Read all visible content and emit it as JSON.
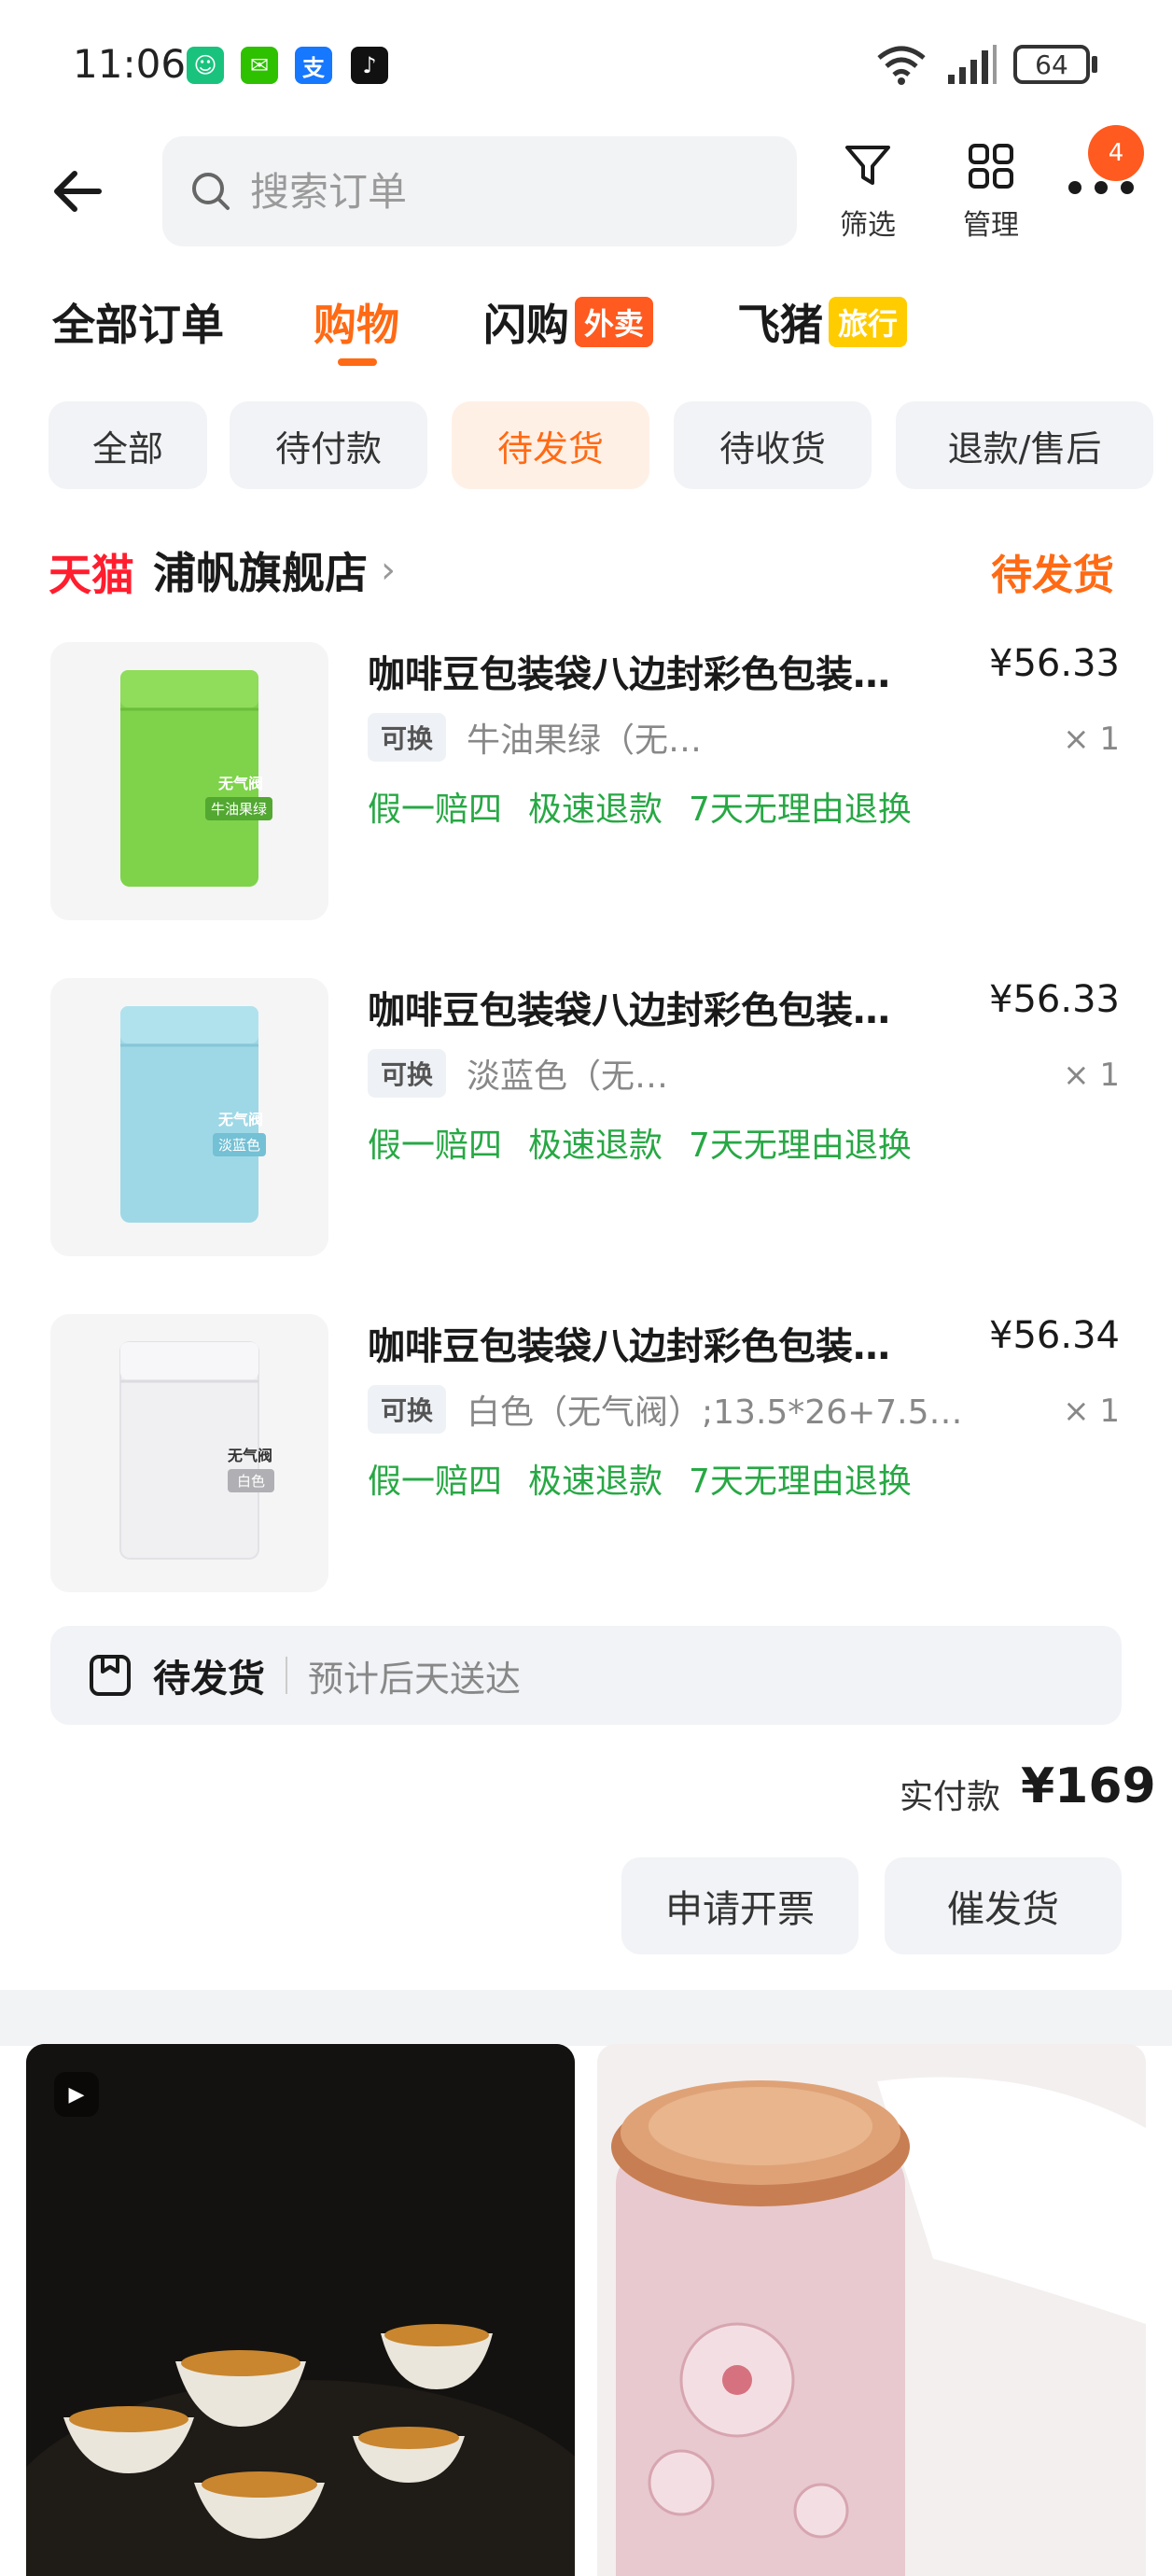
{
  "status_bar": {
    "time": "11:06",
    "battery": "64"
  },
  "search": {
    "placeholder": "搜索订单"
  },
  "header_tools": {
    "filter_label": "筛选",
    "manage_label": "管理",
    "more_badge": "4"
  },
  "main_tabs": [
    {
      "label": "全部订单"
    },
    {
      "label": "购物"
    },
    {
      "label": "闪购",
      "tag": "外卖"
    },
    {
      "label": "飞猪",
      "tag": "旅行"
    }
  ],
  "filters": [
    "全部",
    "待付款",
    "待发货",
    "待收货",
    "退款/售后"
  ],
  "store": {
    "brand": "天猫",
    "name": "浦帆旗舰店",
    "status": "待发货"
  },
  "items": [
    {
      "title": "咖啡豆包装袋八边封彩色包装…",
      "price": "¥56.33",
      "tag": "可换",
      "sku": "牛油果绿（无…",
      "qty": "× 1",
      "services": [
        "假一赔四",
        "极速退款",
        "7天无理由退换"
      ],
      "thumb_label": "无气阀",
      "thumb_color_label": "牛油果绿",
      "bag_color": "#7ed34a"
    },
    {
      "title": "咖啡豆包装袋八边封彩色包装…",
      "price": "¥56.33",
      "tag": "可换",
      "sku": "淡蓝色（无…",
      "qty": "× 1",
      "services": [
        "假一赔四",
        "极速退款",
        "7天无理由退换"
      ],
      "thumb_label": "无气阀",
      "thumb_color_label": "淡蓝色",
      "bag_color": "#9ed8e6"
    },
    {
      "title": "咖啡豆包装袋八边封彩色包装…",
      "price": "¥56.34",
      "tag": "可换",
      "sku": "白色（无气阀）;13.5*26+7.5…",
      "qty": "× 1",
      "services": [
        "假一赔四",
        "极速退款",
        "7天无理由退换"
      ],
      "thumb_label": "无气阀",
      "thumb_color_label": "白色",
      "bag_color": "#f4f4f6"
    }
  ],
  "delivery": {
    "title": "待发货",
    "desc": "预计后天送达"
  },
  "total": {
    "label": "实付款",
    "value": "¥169"
  },
  "actions": {
    "invoice": "申请开票",
    "urge": "催发货"
  },
  "colors": {
    "accent": "#ff6a14",
    "green": "#27a844",
    "tmall_red": "#ff1d2e"
  }
}
